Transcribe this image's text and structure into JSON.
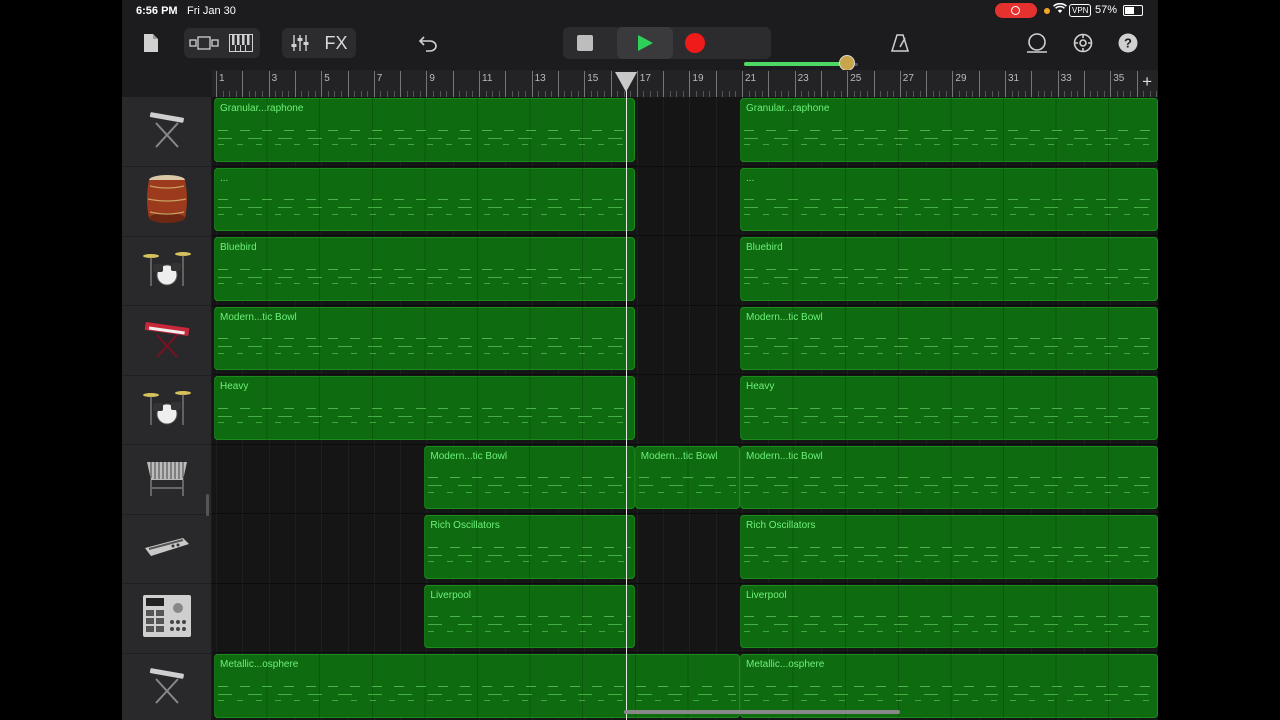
{
  "status": {
    "time": "6:56 PM",
    "date": "Fri Jan 30",
    "vpn": "VPN",
    "battery": "57%"
  },
  "toolbar": {
    "fx_label": "FX",
    "volume_level": 0.9
  },
  "ruler": {
    "bars": [
      "1",
      "3",
      "5",
      "7",
      "9",
      "11",
      "13",
      "15",
      "17",
      "19",
      "21",
      "23",
      "25",
      "27",
      "29",
      "31",
      "33",
      "35"
    ],
    "playhead_bar": 16.6
  },
  "tracks": [
    {
      "icon": "keyboard-stand-icon"
    },
    {
      "icon": "taiko-drum-icon"
    },
    {
      "icon": "drum-kit-icon"
    },
    {
      "icon": "red-synth-icon"
    },
    {
      "icon": "drum-kit-icon"
    },
    {
      "icon": "vibraphone-icon"
    },
    {
      "icon": "synth-module-icon"
    },
    {
      "icon": "drum-machine-icon"
    },
    {
      "icon": "keyboard-stand-icon"
    }
  ],
  "regions": [
    {
      "track": 0,
      "name": "Granular...raphone",
      "start": 1,
      "end": 17
    },
    {
      "track": 0,
      "name": "Granular...raphone",
      "start": 21,
      "end": 37
    },
    {
      "track": 1,
      "name": "...",
      "start": 1,
      "end": 17
    },
    {
      "track": 1,
      "name": "...",
      "start": 21,
      "end": 37
    },
    {
      "track": 2,
      "name": "Bluebird",
      "start": 1,
      "end": 17
    },
    {
      "track": 2,
      "name": "Bluebird",
      "start": 21,
      "end": 37
    },
    {
      "track": 3,
      "name": "Modern...tic Bowl",
      "start": 1,
      "end": 17
    },
    {
      "track": 3,
      "name": "Modern...tic Bowl",
      "start": 21,
      "end": 37
    },
    {
      "track": 4,
      "name": "Heavy",
      "start": 1,
      "end": 17
    },
    {
      "track": 4,
      "name": "Heavy",
      "start": 21,
      "end": 37
    },
    {
      "track": 5,
      "name": "Modern...tic Bowl",
      "start": 9,
      "end": 17
    },
    {
      "track": 5,
      "name": "Modern...tic Bowl",
      "start": 17,
      "end": 21
    },
    {
      "track": 5,
      "name": "Modern...tic Bowl",
      "start": 21,
      "end": 37
    },
    {
      "track": 6,
      "name": "Rich Oscillators",
      "start": 9,
      "end": 17
    },
    {
      "track": 6,
      "name": "Rich Oscillators",
      "start": 21,
      "end": 37
    },
    {
      "track": 7,
      "name": "Liverpool",
      "start": 9,
      "end": 17
    },
    {
      "track": 7,
      "name": "Liverpool",
      "start": 21,
      "end": 37
    },
    {
      "track": 8,
      "name": "Metallic...osphere",
      "start": 1,
      "end": 21
    },
    {
      "track": 8,
      "name": "Metallic...osphere",
      "start": 21,
      "end": 37
    }
  ]
}
